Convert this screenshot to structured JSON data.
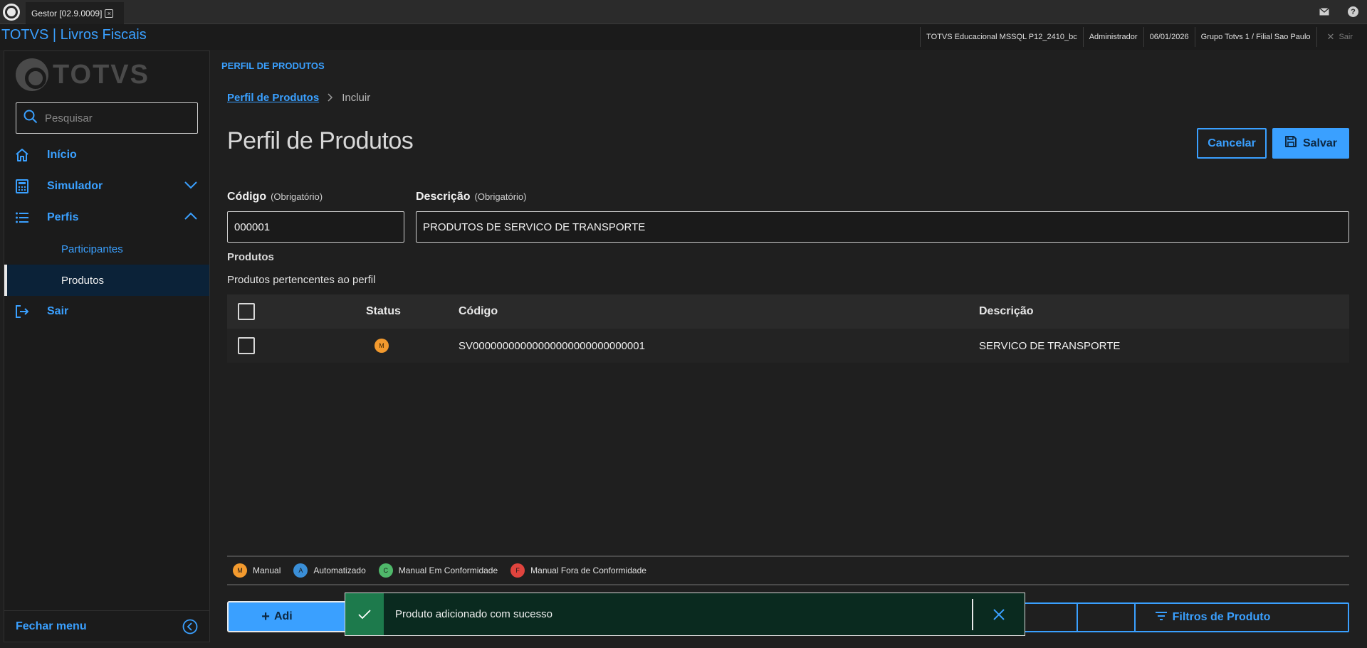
{
  "tabbar": {
    "tab_title": "Gestor [02.9.0009]",
    "tab_close": "×"
  },
  "header": {
    "app_title": "TOTVS | Livros Fiscais",
    "environment": "TOTVS Educacional MSSQL P12_2410_bc",
    "user": "Administrador",
    "date": "06/01/2026",
    "branch": "Grupo Totvs 1 / Filial Sao Paulo",
    "exit_label": "Sair"
  },
  "sidebar": {
    "brand": "TOTVS",
    "search_placeholder": "Pesquisar",
    "items": [
      {
        "label": "Início",
        "icon": "home-icon"
      },
      {
        "label": "Simulador",
        "icon": "calculator-icon"
      },
      {
        "label": "Perfis",
        "icon": "list-icon"
      },
      {
        "label": "Sair",
        "icon": "logout-icon"
      }
    ],
    "subitems": [
      {
        "label": "Participantes"
      },
      {
        "label": "Produtos"
      }
    ],
    "footer_label": "Fechar menu"
  },
  "main": {
    "kicker": "PERFIL DE PRODUTOS",
    "breadcrumb": {
      "link": "Perfil de Produtos",
      "current": "Incluir"
    },
    "title": "Perfil de Produtos",
    "cancel_label": "Cancelar",
    "save_label": "Salvar",
    "fields": {
      "codigo_label": "Código",
      "codigo_optional": "(Obrigatório)",
      "codigo_value": "000001",
      "descricao_label": "Descrição",
      "descricao_optional": "(Obrigatório)",
      "descricao_value": "PRODUTOS DE SERVICO DE TRANSPORTE"
    },
    "section_title": "Produtos",
    "section_subtitle": "Produtos pertencentes ao perfil",
    "table": {
      "headers": {
        "status": "Status",
        "codigo": "Código",
        "descricao": "Descrição"
      },
      "rows": [
        {
          "status": "M",
          "codigo": "SV00000000000000000000000000001",
          "descricao": "SERVICO DE TRANSPORTE"
        }
      ]
    },
    "legend": [
      {
        "letter": "M",
        "label": "Manual",
        "color": "#f39a2e"
      },
      {
        "letter": "A",
        "label": "Automatizado",
        "color": "#3a8fd8"
      },
      {
        "letter": "C",
        "label": "Manual Em Conformidade",
        "color": "#4fb86a"
      },
      {
        "letter": "F",
        "label": "Manual Fora de Conformidade",
        "color": "#e0443e"
      }
    ],
    "add_button_label": "Adi",
    "filter_button_label": "Filtros de Produto"
  },
  "toast": {
    "message": "Produto adicionado com sucesso"
  },
  "colors": {
    "accent": "#3aa0ff",
    "success": "#1d7a4c",
    "background": "#1f1f1f"
  }
}
